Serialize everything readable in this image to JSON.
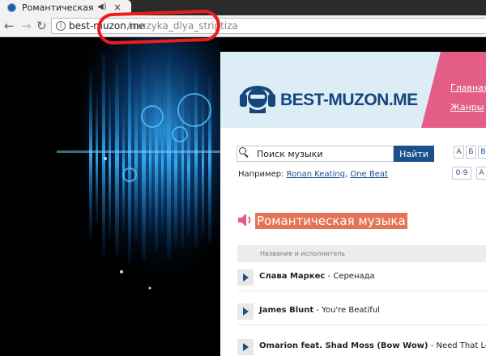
{
  "browser": {
    "tab_title": "Романтическая м",
    "url_domain": "best-muzon.me",
    "url_path": "/muzyka_dlya_striptiza"
  },
  "site": {
    "logo_text": "BEST-MUZON.ME",
    "nav": {
      "main": "Главная",
      "genres": "Жанры"
    }
  },
  "search": {
    "placeholder": "Поиск музыки",
    "button": "Найти",
    "example_label": "Например:",
    "example_1": "Ronan Keating",
    "example_sep": ",",
    "example_2": "One Beat"
  },
  "alphabet": {
    "row1": [
      "А",
      "Б",
      "В"
    ],
    "row2": [
      "0-9",
      "А"
    ]
  },
  "section": {
    "title": "Романтическая музыка",
    "column_header": "Название и исполнитель"
  },
  "tracks": [
    {
      "artist": "Слава Маркес",
      "sep": "-",
      "title": "Серенада"
    },
    {
      "artist": "James Blunt",
      "sep": "-",
      "title": "You're Beatiful"
    },
    {
      "artist": "Omarion feat. Shad Moss (Bow Wow)",
      "sep": "-",
      "title": "Need That Love"
    }
  ],
  "colors": {
    "annotation_ring": "#ee1c1c",
    "brand_blue": "#1b4f8d",
    "nav_pink": "#e35d86",
    "section_title_bg": "#e37556"
  }
}
